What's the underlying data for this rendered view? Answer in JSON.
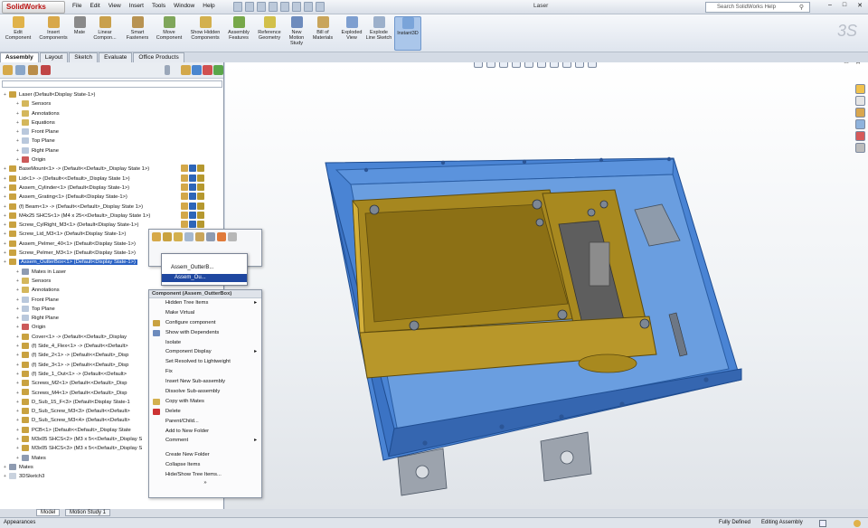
{
  "app": {
    "logo": "SolidWorks",
    "document_title": "Laser"
  },
  "menu": [
    "File",
    "Edit",
    "View",
    "Insert",
    "Tools",
    "Window",
    "Help"
  ],
  "search": {
    "placeholder": "Search SolidWorks Help"
  },
  "ribbon": [
    {
      "label": "Edit Component",
      "color": "#e0b24a"
    },
    {
      "label": "Insert Components",
      "color": "#d8a84a"
    },
    {
      "label": "Mate",
      "color": "#8a8a8a"
    },
    {
      "label": "Linear Compon...",
      "color": "#c9a04c"
    },
    {
      "label": "Smart Fasteners",
      "color": "#b89352"
    },
    {
      "label": "Move Component",
      "color": "#7fa65b"
    },
    {
      "label": "Show Hidden Components",
      "color": "#d3b04e"
    },
    {
      "label": "Assembly Features",
      "color": "#77a84a"
    },
    {
      "label": "Reference Geometry",
      "color": "#d2c04a"
    },
    {
      "label": "New Motion Study",
      "color": "#6d8bbd"
    },
    {
      "label": "Bill of Materials",
      "color": "#c9a55b"
    },
    {
      "label": "Exploded View",
      "color": "#7e9fd0"
    },
    {
      "label": "Explode Line Sketch",
      "color": "#9cb0cb"
    },
    {
      "label": "Instant3D",
      "color": "#7aa4d9"
    }
  ],
  "cm_tabs": [
    "Assembly",
    "Layout",
    "Sketch",
    "Evaluate",
    "Office Products"
  ],
  "tree": [
    {
      "text": "Laser  (Default<Display State-1>)",
      "indent": 0,
      "icon": "#c9a240"
    },
    {
      "text": "Sensors",
      "indent": 1,
      "icon": "#d4b75c"
    },
    {
      "text": "Annotations",
      "indent": 1,
      "icon": "#d4b75c"
    },
    {
      "text": "Equations",
      "indent": 1,
      "icon": "#d4b75c"
    },
    {
      "text": "Front Plane",
      "indent": 1,
      "icon": "#b9c8dc"
    },
    {
      "text": "Top Plane",
      "indent": 1,
      "icon": "#b9c8dc"
    },
    {
      "text": "Right Plane",
      "indent": 1,
      "icon": "#b9c8dc"
    },
    {
      "text": "Origin",
      "indent": 1,
      "icon": "#cc5a5a"
    },
    {
      "text": "BaseMount<1> -> (Default<<Default>_Display State 1>)",
      "indent": 0,
      "icon": "#c9a240"
    },
    {
      "text": "Lid<1> -> (Default<<Default>_Display State 1>)",
      "indent": 0,
      "icon": "#c9a240"
    },
    {
      "text": "Assem_Cylinder<1> (Default<Display State-1>)",
      "indent": 0,
      "icon": "#c9a240"
    },
    {
      "text": "Assem_Grating<1> (Default<Display State-1>)",
      "indent": 0,
      "icon": "#c9a240"
    },
    {
      "text": "(f) Beam<1> -> (Default<<Default>_Display State 1>)",
      "indent": 0,
      "icon": "#c9a240"
    },
    {
      "text": "M4x25 SHCS<1> (M4 x 25<<Default>_Display State 1>)",
      "indent": 0,
      "icon": "#c9a240"
    },
    {
      "text": "Screw_CylRight_M3<1> (Default<Display State-1>)",
      "indent": 0,
      "icon": "#c9a240"
    },
    {
      "text": "Screw_Lid_M3<1> (Default<Display State-1>)",
      "indent": 0,
      "icon": "#c9a240"
    },
    {
      "text": "Assem_Pelmer_40<1> (Default<Display State-1>)",
      "indent": 0,
      "icon": "#c9a240"
    },
    {
      "text": "Screw_Pelmer_M3<1> (Default<Display State-1>)",
      "indent": 0,
      "icon": "#c9a240"
    },
    {
      "text": "Assem_OutterBox<1> (Default<Display State-1>)",
      "indent": 0,
      "icon": "#c9a240",
      "selected": true
    },
    {
      "text": "Mates in Laser",
      "indent": 1,
      "icon": "#8e9bb1"
    },
    {
      "text": "Sensors",
      "indent": 1,
      "icon": "#d4b75c"
    },
    {
      "text": "Annotations",
      "indent": 1,
      "icon": "#d4b75c"
    },
    {
      "text": "Front Plane",
      "indent": 1,
      "icon": "#b9c8dc"
    },
    {
      "text": "Top Plane",
      "indent": 1,
      "icon": "#b9c8dc"
    },
    {
      "text": "Right Plane",
      "indent": 1,
      "icon": "#b9c8dc"
    },
    {
      "text": "Origin",
      "indent": 1,
      "icon": "#cc5a5a"
    },
    {
      "text": "Cover<1> -> (Default<<Default>_Display",
      "indent": 1,
      "icon": "#c9a240"
    },
    {
      "text": "(f) Side_4_Flex<1> -> (Default<<Default>",
      "indent": 1,
      "icon": "#c9a240"
    },
    {
      "text": "(f) Side_2<1> -> (Default<<Default>_Disp",
      "indent": 1,
      "icon": "#c9a240"
    },
    {
      "text": "(f) Side_3<1> -> (Default<<Default>_Disp",
      "indent": 1,
      "icon": "#c9a240"
    },
    {
      "text": "(f) Side_1_Out<1> -> (Default<<Default>",
      "indent": 1,
      "icon": "#c9a240"
    },
    {
      "text": "Screws_M2<1> (Default<<Default>_Disp",
      "indent": 1,
      "icon": "#c9a240"
    },
    {
      "text": "Screws_M4<1> (Default<<Default>_Disp",
      "indent": 1,
      "icon": "#c9a240"
    },
    {
      "text": "D_Sub_15_F<3> (Default<Display State-1",
      "indent": 1,
      "icon": "#c9a240"
    },
    {
      "text": "D_Sub_Screw_M3<3> (Default<<Default>",
      "indent": 1,
      "icon": "#c9a240"
    },
    {
      "text": "D_Sub_Screw_M3<4> (Default<<Default>",
      "indent": 1,
      "icon": "#c9a240"
    },
    {
      "text": "PCB<1> (Default<<Default>_Display State",
      "indent": 1,
      "icon": "#c9a240"
    },
    {
      "text": "M3x05 SHCS<2> (M3 x 5<<Default>_Display S",
      "indent": 1,
      "icon": "#c9a240"
    },
    {
      "text": "M3x05 SHCS<3> (M3 x 5<<Default>_Display S",
      "indent": 1,
      "icon": "#c9a240"
    },
    {
      "text": "Mates",
      "indent": 1,
      "icon": "#8e9bb1"
    },
    {
      "text": "Mates",
      "indent": 0,
      "icon": "#8e9bb1"
    },
    {
      "text": "3DSketch3",
      "indent": 0,
      "icon": "#c9d2de"
    }
  ],
  "select_popup": {
    "item1": "Assem_OutterB...",
    "item2": "Assem_Ou..."
  },
  "context_menu": {
    "header": "Component (Assem_OutterBox)",
    "items": [
      {
        "label": "Hidden Tree Items",
        "submenu": true
      },
      {
        "label": "Make Virtual"
      },
      {
        "label": "Configure component",
        "icon": "#c9a240"
      },
      {
        "label": "Show with Dependents",
        "icon": "#6d8bbd"
      },
      {
        "label": "Isolate"
      },
      {
        "label": "Component Display",
        "submenu": true
      },
      {
        "label": "Set Resolved to Lightweight"
      },
      {
        "label": "Fix"
      },
      {
        "label": "Insert New Sub-assembly"
      },
      {
        "label": "Dissolve Sub-assembly"
      },
      {
        "label": "Copy with Mates",
        "icon": "#d3b04e"
      },
      {
        "label": "Delete",
        "icon": "#cc3333"
      },
      {
        "label": "Parent/Child..."
      },
      {
        "label": "Add to New Folder"
      },
      {
        "label": "Comment",
        "submenu": true
      }
    ],
    "items2": [
      {
        "label": "Create New Folder"
      },
      {
        "label": "Collapse Items"
      },
      {
        "label": "Hide/Show Tree Items..."
      }
    ],
    "more": "»"
  },
  "bottom_tabs": [
    "Model",
    "Motion Study 1"
  ],
  "status": {
    "left": "Appearances",
    "center": "Fully Defined",
    "right": "Editing Assembly"
  },
  "colors": {
    "box_blue": "#3d7ad0",
    "gold": "#a88b23",
    "accent": "#2a62c4"
  }
}
